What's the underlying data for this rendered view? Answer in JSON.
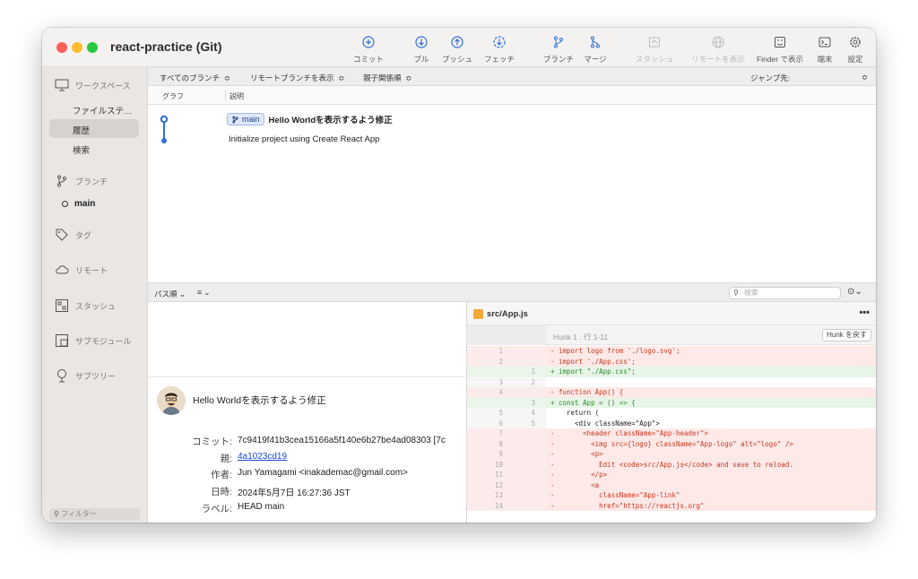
{
  "window": {
    "title": "react-practice (Git)"
  },
  "toolbar": {
    "commit": "コミット",
    "pull": "プル",
    "push": "プッシュ",
    "fetch": "フェッチ",
    "branch": "ブランチ",
    "merge": "マージ",
    "stash": "スタッシュ",
    "show_remote": "リモートを表示",
    "show_finder": "Finder で表示",
    "terminal": "端末",
    "settings": "設定"
  },
  "sidebar": {
    "workspace": "ワークスペース",
    "file_status": "ファイルステ…",
    "history": "履歴",
    "search": "検索",
    "branches": "ブランチ",
    "main_branch": "main",
    "tags": "タグ",
    "remotes": "リモート",
    "stashes": "スタッシュ",
    "submodules": "サブモジュール",
    "subtrees": "サブツリー",
    "filter_placeholder": "フィルター"
  },
  "filterbar": {
    "all_branches": "すべてのブランチ",
    "show_remote_branches": "リモートブランチを表示",
    "parent_order": "親子関係順",
    "jump_to": "ジャンプ先:"
  },
  "columns": {
    "graph": "グラフ",
    "description": "説明"
  },
  "commits": [
    {
      "branch": "main",
      "message": "Hello Worldを表示するよう修正"
    },
    {
      "message": "Initialize project using Create React App"
    }
  ],
  "midbar": {
    "path_order": "パス順",
    "search_placeholder": "検索"
  },
  "commit_info": {
    "title": "Hello Worldを表示するよう修正",
    "commit_label": "コミット:",
    "commit_value": "7c9419f41b3cea15166a5f140e6b27be4ad08303 [7c",
    "parent_label": "親:",
    "parent_value": "4a1023cd19",
    "author_label": "作者:",
    "author_value": "Jun Yamagami <inakademac@gmail.com>",
    "date_label": "日時:",
    "date_value": "2024年5月7日 16:27:36 JST",
    "labels_label": "ラベル:",
    "labels_value": "HEAD main"
  },
  "diff": {
    "file": "src/App.js",
    "hunk_label": "Hunk 1 : 行 1-11",
    "revert_hunk": "Hunk を戻す",
    "lines": [
      {
        "type": "del",
        "old": "1",
        "new": "",
        "sign": "-",
        "text": "import logo from './logo.svg';"
      },
      {
        "type": "del",
        "old": "2",
        "new": "",
        "sign": "-",
        "text": "import './App.css';"
      },
      {
        "type": "add",
        "old": "",
        "new": "1",
        "sign": "+",
        "text": "import \"./App.css\";"
      },
      {
        "type": "ctx",
        "old": "3",
        "new": "2",
        "sign": "",
        "text": ""
      },
      {
        "type": "del",
        "old": "4",
        "new": "",
        "sign": "-",
        "text": "function App() {"
      },
      {
        "type": "add",
        "old": "",
        "new": "3",
        "sign": "+",
        "text": "const App = () => {"
      },
      {
        "type": "ctx",
        "old": "5",
        "new": "4",
        "sign": "",
        "text": "  return ("
      },
      {
        "type": "ctx",
        "old": "6",
        "new": "5",
        "sign": "",
        "text": "    <div className=\"App\">"
      },
      {
        "type": "del",
        "old": "7",
        "new": "",
        "sign": "-",
        "text": "      <header className=\"App-header\">"
      },
      {
        "type": "del",
        "old": "8",
        "new": "",
        "sign": "-",
        "text": "        <img src={logo} className=\"App-logo\" alt=\"logo\" />"
      },
      {
        "type": "del",
        "old": "9",
        "new": "",
        "sign": "-",
        "text": "        <p>"
      },
      {
        "type": "del",
        "old": "10",
        "new": "",
        "sign": "-",
        "text": "          Edit <code>src/App.js</code> and save to reload."
      },
      {
        "type": "del",
        "old": "11",
        "new": "",
        "sign": "-",
        "text": "        </p>"
      },
      {
        "type": "del",
        "old": "12",
        "new": "",
        "sign": "-",
        "text": "        <a"
      },
      {
        "type": "del",
        "old": "13",
        "new": "",
        "sign": "-",
        "text": "          className=\"App-link\""
      },
      {
        "type": "del",
        "old": "14",
        "new": "",
        "sign": "-",
        "text": "          href=\"https://reactjs.org\""
      }
    ]
  },
  "colors": {
    "accent": "#2f6fd6",
    "del_bg": "#fde9e7",
    "add_bg": "#e6f5e6"
  }
}
